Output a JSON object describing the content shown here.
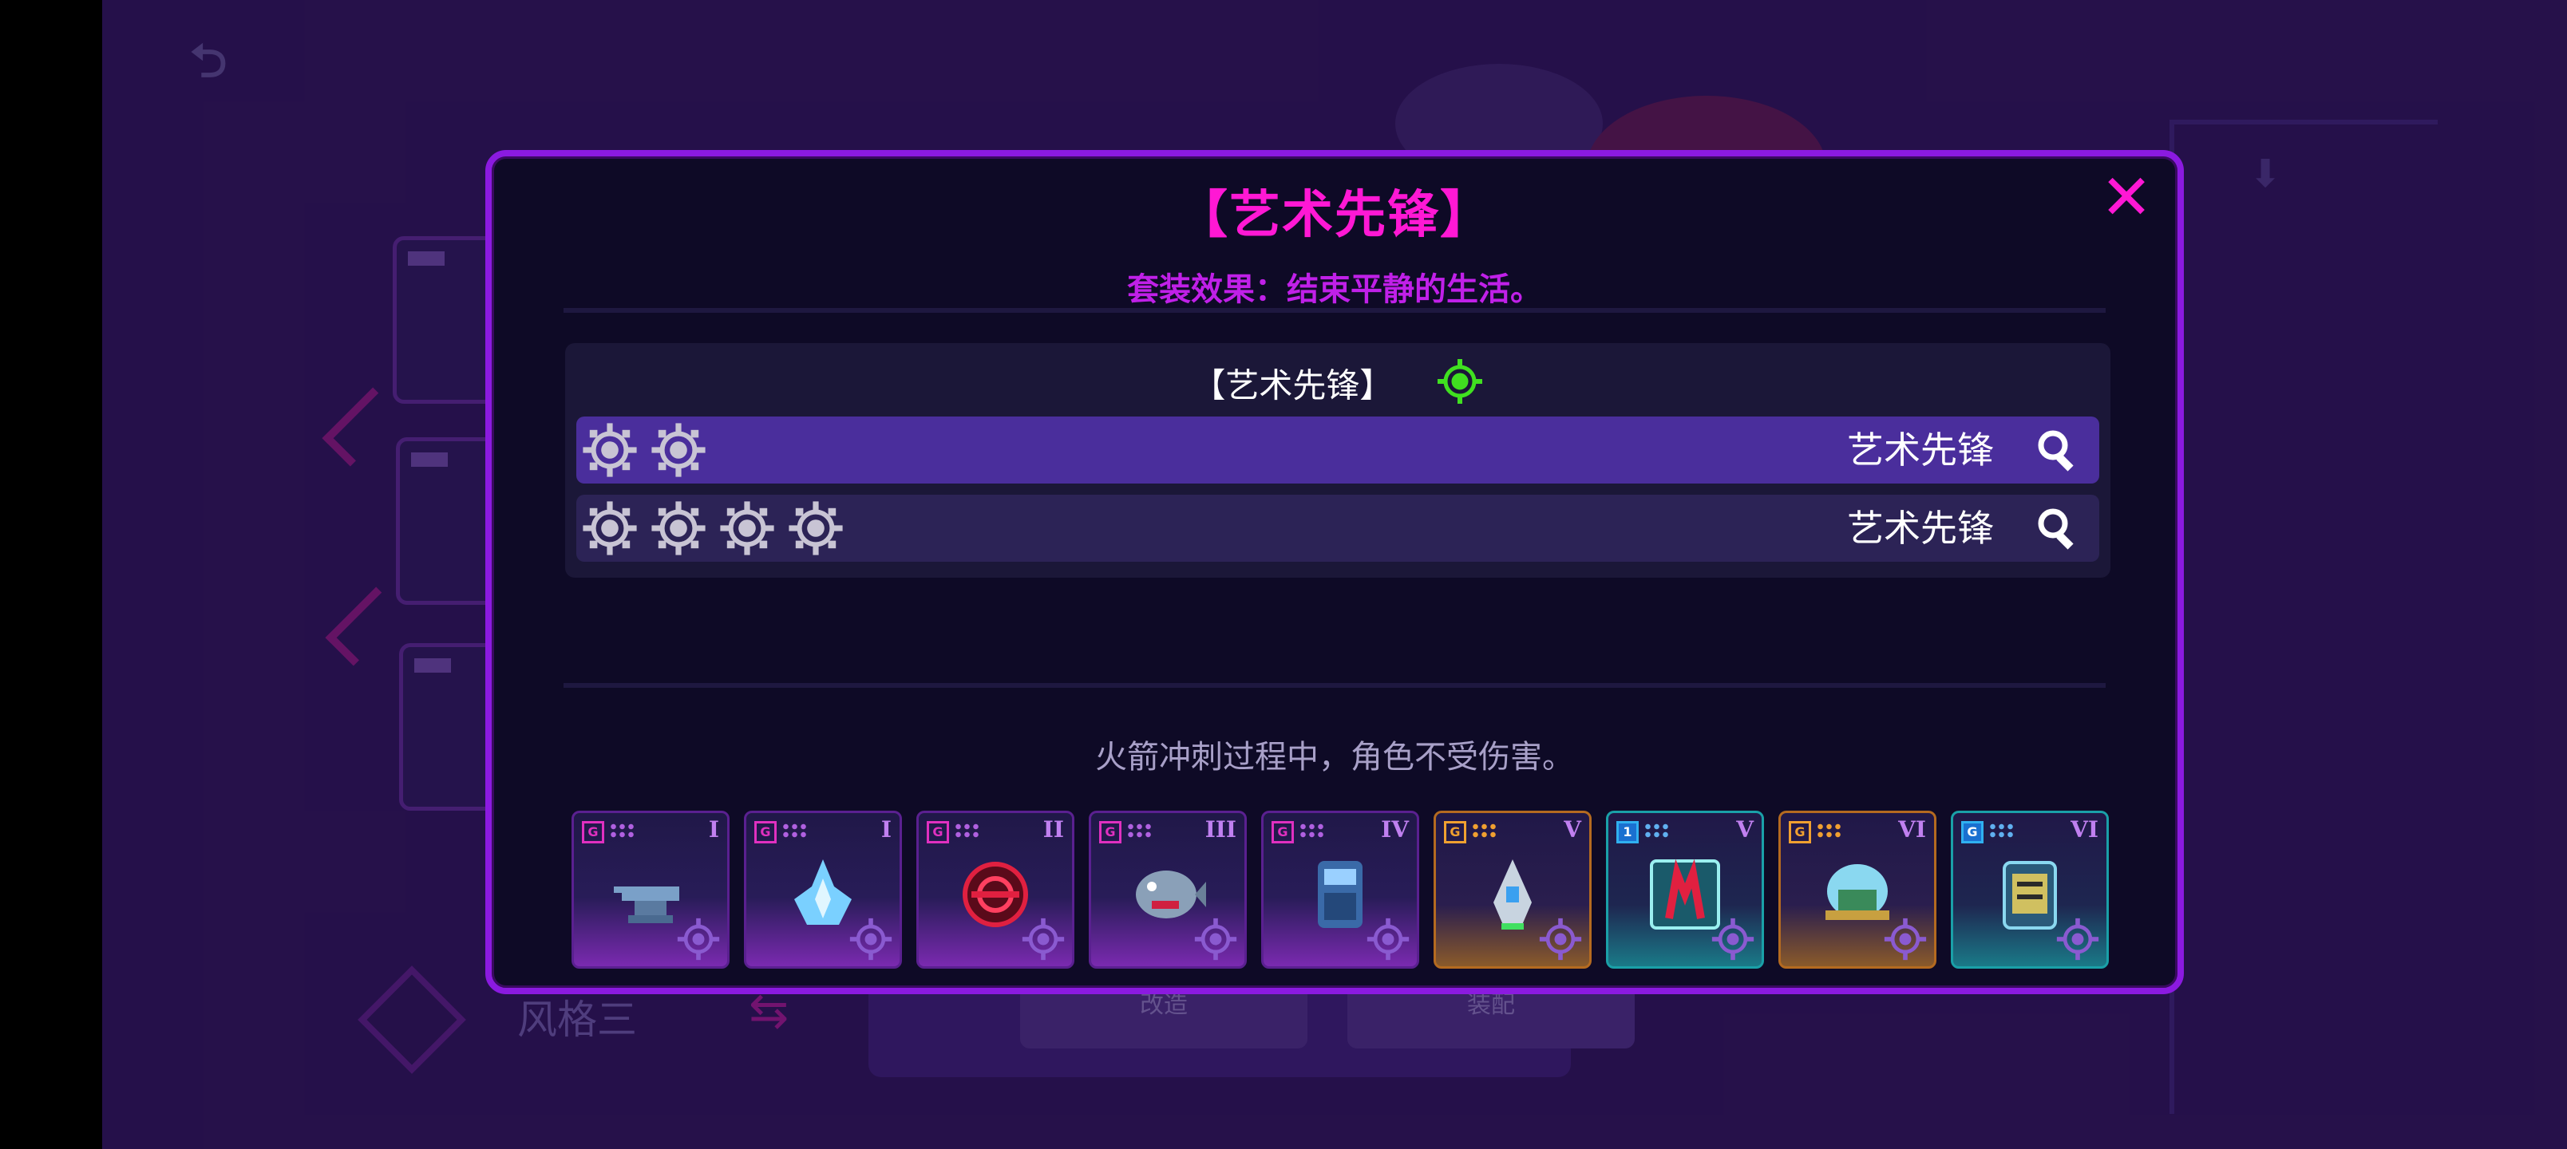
{
  "dialog": {
    "title": "【艺术先锋】",
    "set_effect": "套装效果：结束平静的生活。",
    "set_header": "【艺术先锋】",
    "tiers": [
      {
        "gear_count": 2,
        "name": "艺术先锋",
        "active": true
      },
      {
        "gear_count": 4,
        "name": "艺术先锋",
        "active": false
      }
    ],
    "description": "火箭冲刺过程中，角色不受伤害。",
    "cards": [
      {
        "badge": "G",
        "level": "I",
        "rarity": "purple",
        "item_icon": "anvil-icon"
      },
      {
        "badge": "G",
        "level": "I",
        "rarity": "purple",
        "item_icon": "blue-flame-icon"
      },
      {
        "badge": "G",
        "level": "II",
        "rarity": "purple",
        "item_icon": "red-orb-icon"
      },
      {
        "badge": "G",
        "level": "III",
        "rarity": "purple",
        "item_icon": "piranha-fish-icon"
      },
      {
        "badge": "G",
        "level": "IV",
        "rarity": "purple",
        "item_icon": "machine-cabinet-icon"
      },
      {
        "badge": "G",
        "level": "V",
        "rarity": "gold",
        "item_icon": "rocket-capsule-icon"
      },
      {
        "badge": "1",
        "level": "V",
        "rarity": "cyan",
        "item_icon": "red-claw-icon"
      },
      {
        "badge": "G",
        "level": "VI",
        "rarity": "gold",
        "item_icon": "glass-dome-robot-icon"
      },
      {
        "badge": "G",
        "level": "VI",
        "rarity": "cyan",
        "item_icon": "tablet-device-icon"
      }
    ]
  },
  "background": {
    "style_label": "风格三",
    "bottom_buttons": [
      "改造",
      "装配"
    ]
  },
  "colors": {
    "accent_magenta": "#ff18d4",
    "effect_purple": "#c020e8",
    "dialog_border": "#8b1ae0",
    "active_row": "#4a2e9c",
    "inactive_row": "#2c2356",
    "active_gear": "#40e020"
  }
}
